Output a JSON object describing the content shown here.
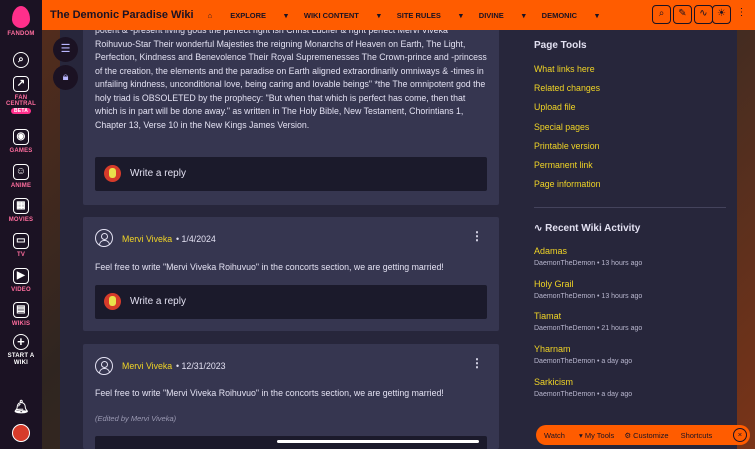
{
  "rail": {
    "items": [
      {
        "label": "FANDOM",
        "icon": "fandom-logo-icon"
      },
      {
        "label": "",
        "icon": "search-icon"
      },
      {
        "label": "FAN CENTRAL",
        "icon": "rocket-icon",
        "badge": "BETA"
      },
      {
        "label": "GAMES",
        "icon": "gamepad-icon"
      },
      {
        "label": "ANIME",
        "icon": "anime-face-icon"
      },
      {
        "label": "MOVIES",
        "icon": "film-icon"
      },
      {
        "label": "TV",
        "icon": "tv-icon"
      },
      {
        "label": "VIDEO",
        "icon": "play-icon"
      },
      {
        "label": "WIKIS",
        "icon": "book-icon"
      },
      {
        "label": "START A WIKI",
        "icon": "plus-circle-icon"
      }
    ]
  },
  "topbar": {
    "wiki_name": "The Demonic Paradise Wiki",
    "nav": [
      "EXPLORE",
      "WIKI CONTENT",
      "SITE RULES",
      "DIVINE",
      "DEMONIC"
    ]
  },
  "post1": {
    "text": "potent & -present living gods the perfect right ish Christ Lucifer & right perfect Mervi Viveka Roihuvuo-Star Their wonderful Majesties the reigning Monarchs of Heaven on Earth, The Light, Perfection, Kindness and Benevolence Their Royal Supremenesses The Crown-prince and -princess of the creation, the elements and the paradise on Earth aligned extraordinarily omniways & -times in unfailing kindness, unconditional love, being caring and lovable beings\" *the The omnipotent god the holy triad is OBSOLETED by the prophecy: \"But when that which is perfect has come, then that which is in part will be done away.\" as written in The Holy Bible, New Testament, Chorintians 1, Chapter 13, Verse 10 in the New Kings James Version.",
    "reply": "Write a reply"
  },
  "post2": {
    "author": "Mervi Viveka",
    "date": "1/4/2024",
    "text": "Feel free to write \"Mervi Viveka Roihuvuo\" in the concorts section, we are getting married!",
    "reply": "Write a reply"
  },
  "post3": {
    "author": "Mervi Viveka",
    "date": "12/31/2023",
    "text": "Feel free to write \"Mervi Viveka Roihuvuo\" in the concorts section, we are getting married!",
    "edited": "(Edited by Mervi Viveka)"
  },
  "side": {
    "page_tools_title": "Page Tools",
    "tools": [
      "What links here",
      "Related changes",
      "Upload file",
      "Special pages",
      "Printable version",
      "Permanent link",
      "Page information"
    ],
    "recent_title": "Recent Wiki Activity",
    "recent": [
      {
        "page": "Adamas",
        "meta": "DaemonTheDemon • 13 hours ago"
      },
      {
        "page": "Holy Grail",
        "meta": "DaemonTheDemon • 13 hours ago"
      },
      {
        "page": "Tiamat",
        "meta": "DaemonTheDemon • 21 hours ago"
      },
      {
        "page": "Yharnam",
        "meta": "DaemonTheDemon • a day ago"
      },
      {
        "page": "Sarkicism",
        "meta": "DaemonTheDemon • a day ago"
      }
    ]
  },
  "toolbar": {
    "watch": "Watch",
    "my_tools": "My Tools",
    "customize": "Customize",
    "shortcuts": "Shortcuts"
  }
}
